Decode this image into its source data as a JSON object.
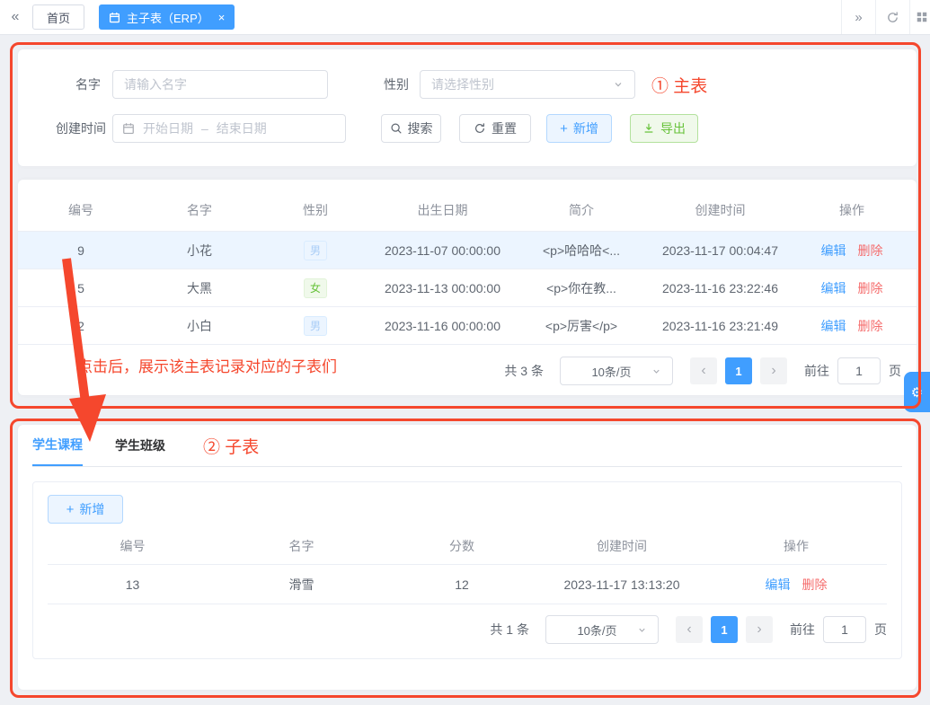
{
  "colors": {
    "accent": "#409eff",
    "success": "#67c23a",
    "danger": "#f56c6c",
    "annotation": "#f5472d",
    "selected_row_bg": "#ecf5ff",
    "male_tag_bg": "#ecf5ff",
    "male_tag_text": "#a9cdf7",
    "female_tag_bg": "#f0f9eb",
    "female_tag_text": "#67c23a"
  },
  "icons": {
    "collapse": "«",
    "expand": "»",
    "close": "×",
    "plus": "+",
    "gear": "⚙",
    "prev": "‹",
    "next": "›"
  },
  "tabbar": {
    "home": "首页",
    "active": "主子表（ERP）"
  },
  "filter": {
    "name_label": "名字",
    "name_placeholder": "请输入名字",
    "gender_label": "性别",
    "gender_placeholder": "请选择性别",
    "created_label": "创建时间",
    "date_start_placeholder": "开始日期",
    "date_separator": "–",
    "date_end_placeholder": "结束日期",
    "search_button": "搜索",
    "reset_button": "重置",
    "add_button": "新增",
    "export_button": "导出"
  },
  "annotations": {
    "main_label": "① 主表",
    "child_label": "② 子表",
    "arrow_note": "点击后，展示该主表记录对应的子表们"
  },
  "main_table": {
    "headers": [
      "编号",
      "名字",
      "性别",
      "出生日期",
      "简介",
      "创建时间",
      "操作"
    ],
    "actions": {
      "edit": "编辑",
      "del": "删除"
    },
    "rows": [
      {
        "id": "9",
        "name": "小花",
        "gender": "男",
        "birth": "2023-11-07 00:00:00",
        "intro": "<p>哈哈哈<...",
        "created": "2023-11-17 00:04:47"
      },
      {
        "id": "5",
        "name": "大黑",
        "gender": "女",
        "birth": "2023-11-13 00:00:00",
        "intro": "<p>你在教...",
        "created": "2023-11-16 23:22:46"
      },
      {
        "id": "2",
        "name": "小白",
        "gender": "男",
        "birth": "2023-11-16 00:00:00",
        "intro": "<p>厉害</p>",
        "created": "2023-11-16 23:21:49"
      }
    ],
    "pagination": {
      "total": "共 3 条",
      "size": "10条/页",
      "page": "1",
      "goto": "前往",
      "goto_value": "1",
      "unit": "页"
    }
  },
  "child": {
    "tab_courses": "学生课程",
    "tab_classes": "学生班级",
    "add_button": "新增",
    "headers": [
      "编号",
      "名字",
      "分数",
      "创建时间",
      "操作"
    ],
    "actions": {
      "edit": "编辑",
      "del": "删除"
    },
    "rows": [
      {
        "id": "13",
        "name": "滑雪",
        "score": "12",
        "created": "2023-11-17 13:13:20"
      }
    ],
    "pagination": {
      "total": "共 1 条",
      "size": "10条/页",
      "page": "1",
      "goto": "前往",
      "goto_value": "1",
      "unit": "页"
    }
  }
}
